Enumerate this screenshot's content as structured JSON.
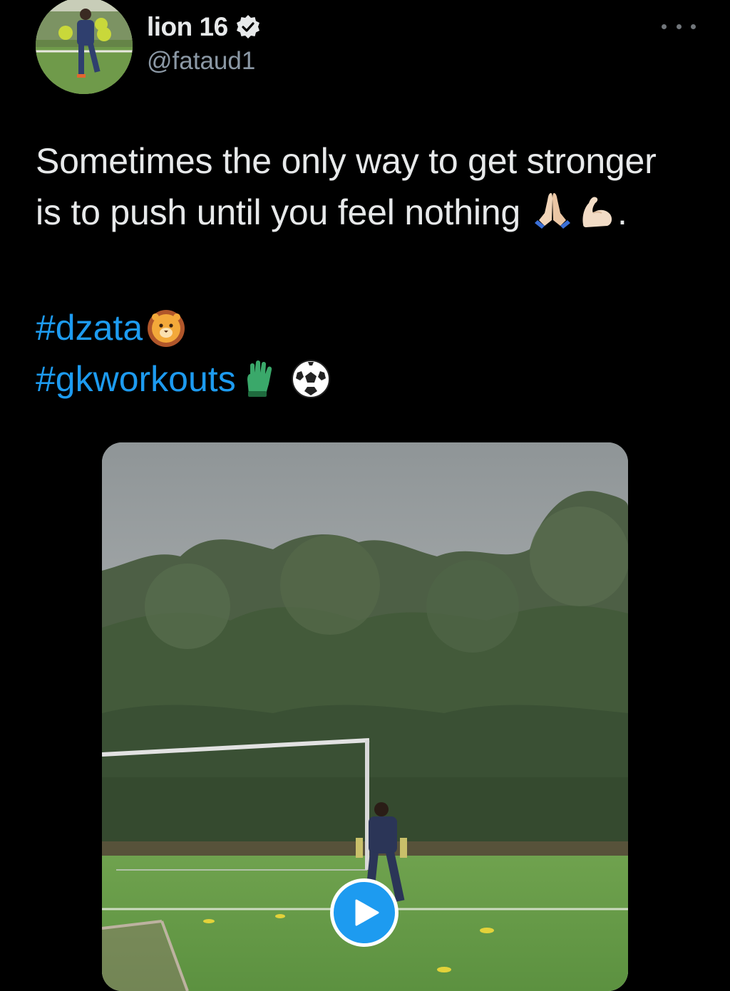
{
  "author": {
    "display_name": "lion 16",
    "handle": "@fataud1",
    "verified": true
  },
  "tweet": {
    "text_main": "Sometimes the only way to get stronger is to push until you feel nothing",
    "text_emojis": [
      "folded-hands-icon",
      "flexed-biceps-icon"
    ],
    "text_end": ".",
    "hashtags": [
      {
        "tag": "#dzata",
        "emojis": [
          "lion-face-icon"
        ]
      },
      {
        "tag": "#gkworkouts",
        "emojis": [
          "gloves-icon",
          "soccer-ball-icon"
        ]
      }
    ]
  },
  "media": {
    "type": "video",
    "play_icon": "play-icon"
  },
  "colors": {
    "background": "#000000",
    "text": "#e7e9ea",
    "secondary_text": "#8b98a5",
    "link": "#1d9bf0",
    "play_button": "#1d9bf0"
  }
}
